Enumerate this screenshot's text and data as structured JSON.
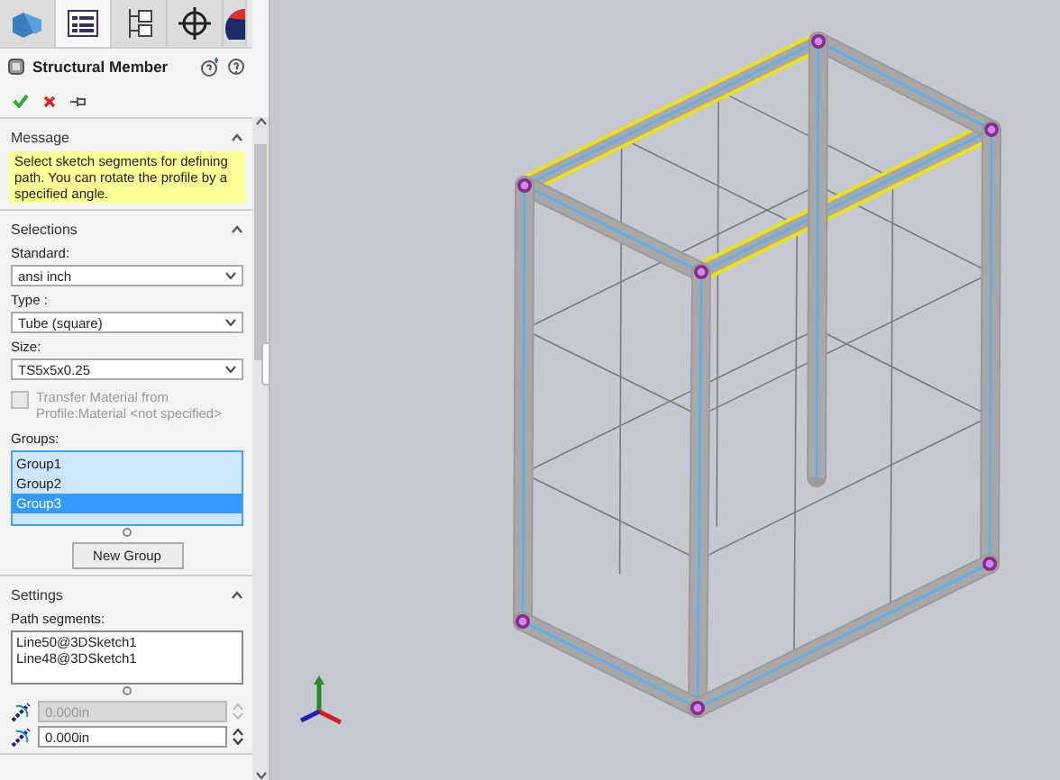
{
  "property_manager": {
    "tabs": [
      {
        "kind": "feature",
        "selected": false
      },
      {
        "kind": "property",
        "selected": true
      },
      {
        "kind": "config",
        "selected": false
      },
      {
        "kind": "target",
        "selected": false
      },
      {
        "kind": "appearance",
        "selected": false
      }
    ],
    "title": "Structural Member",
    "message": {
      "title": "Message",
      "text": "Select sketch segments for defining path. You can rotate the profile by a specified angle.",
      "expanded": true
    },
    "selections": {
      "title": "Selections",
      "expanded": true,
      "dropdowns": [
        {
          "label": "Standard:",
          "value": "ansi inch"
        },
        {
          "label": "Type :",
          "value": "Tube (square)"
        },
        {
          "label": "Size:",
          "value": "TS5x5x0.25"
        }
      ],
      "transfer_material": {
        "label": "Transfer Material from Profile:Material <not specified>",
        "checked": false,
        "disabled": true
      },
      "groups_label": "Groups:",
      "groups": [
        {
          "name": "Group1",
          "selected": false
        },
        {
          "name": "Group2",
          "selected": false
        },
        {
          "name": "Group3",
          "selected": true
        }
      ],
      "new_group_button": "New Group"
    },
    "settings": {
      "title": "Settings",
      "expanded": true,
      "path_segments_label": "Path segments:",
      "path_segments": [
        "Line50@3DSketch1",
        "Line48@3DSketch1"
      ],
      "angle_fields": [
        {
          "value": "0.000in",
          "disabled": true
        },
        {
          "value": "0.000in",
          "disabled": false
        }
      ]
    }
  }
}
